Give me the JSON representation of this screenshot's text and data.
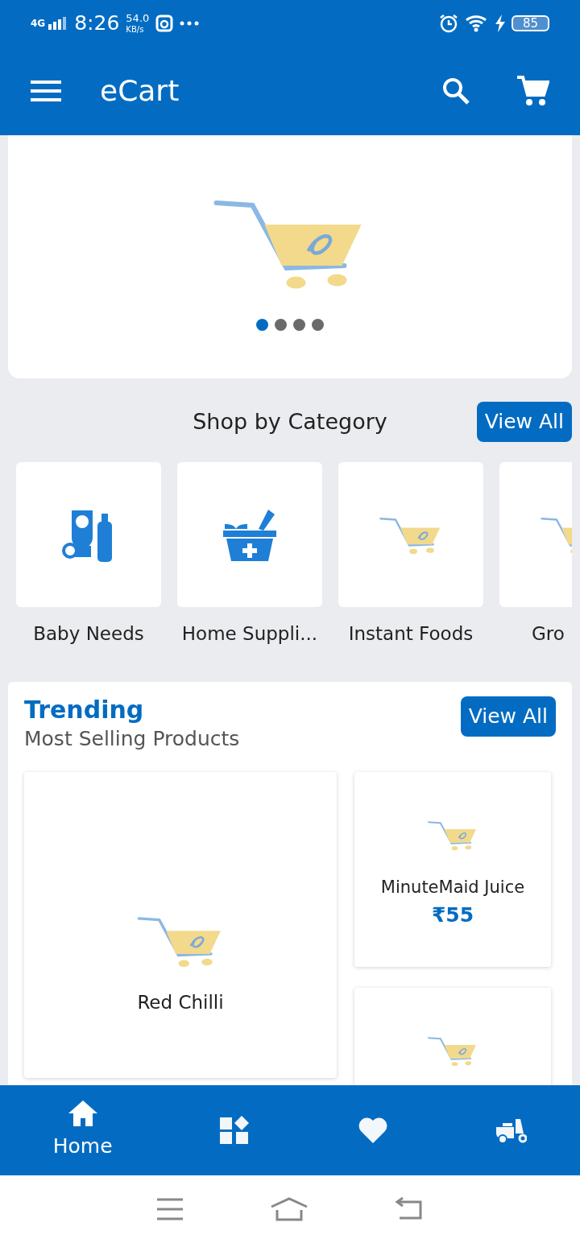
{
  "status_bar": {
    "network": "4G",
    "time": "8:26",
    "speed": "54.0",
    "speed_unit": "KB/s",
    "battery": "85"
  },
  "app_bar": {
    "title": "eCart"
  },
  "banner": {
    "slides": [
      {
        "selected": true
      },
      {
        "selected": false
      },
      {
        "selected": false
      },
      {
        "selected": false
      }
    ]
  },
  "categories": {
    "title": "Shop by Category",
    "button": "View All",
    "items": [
      {
        "label": "Baby Needs",
        "kind": "baby"
      },
      {
        "label": "Home Suppli...",
        "kind": "medicine"
      },
      {
        "label": "Instant Foods",
        "kind": "logo"
      },
      {
        "label": "Gro",
        "kind": "logo"
      }
    ]
  },
  "trending": {
    "title": "Trending",
    "subtitle": "Most Selling Products",
    "button": "View All",
    "featured": {
      "name": "Red Chilli"
    },
    "products": [
      {
        "kind": "full",
        "name": "MinuteMaid Juice",
        "price": "₹55"
      },
      {
        "kind": "image-only"
      }
    ]
  },
  "bottom_nav": [
    {
      "kind": "home",
      "label": "Home",
      "selected": true
    },
    {
      "kind": "categories",
      "selected": false
    },
    {
      "kind": "favorites",
      "selected": false
    },
    {
      "kind": "delivery",
      "selected": false
    }
  ]
}
